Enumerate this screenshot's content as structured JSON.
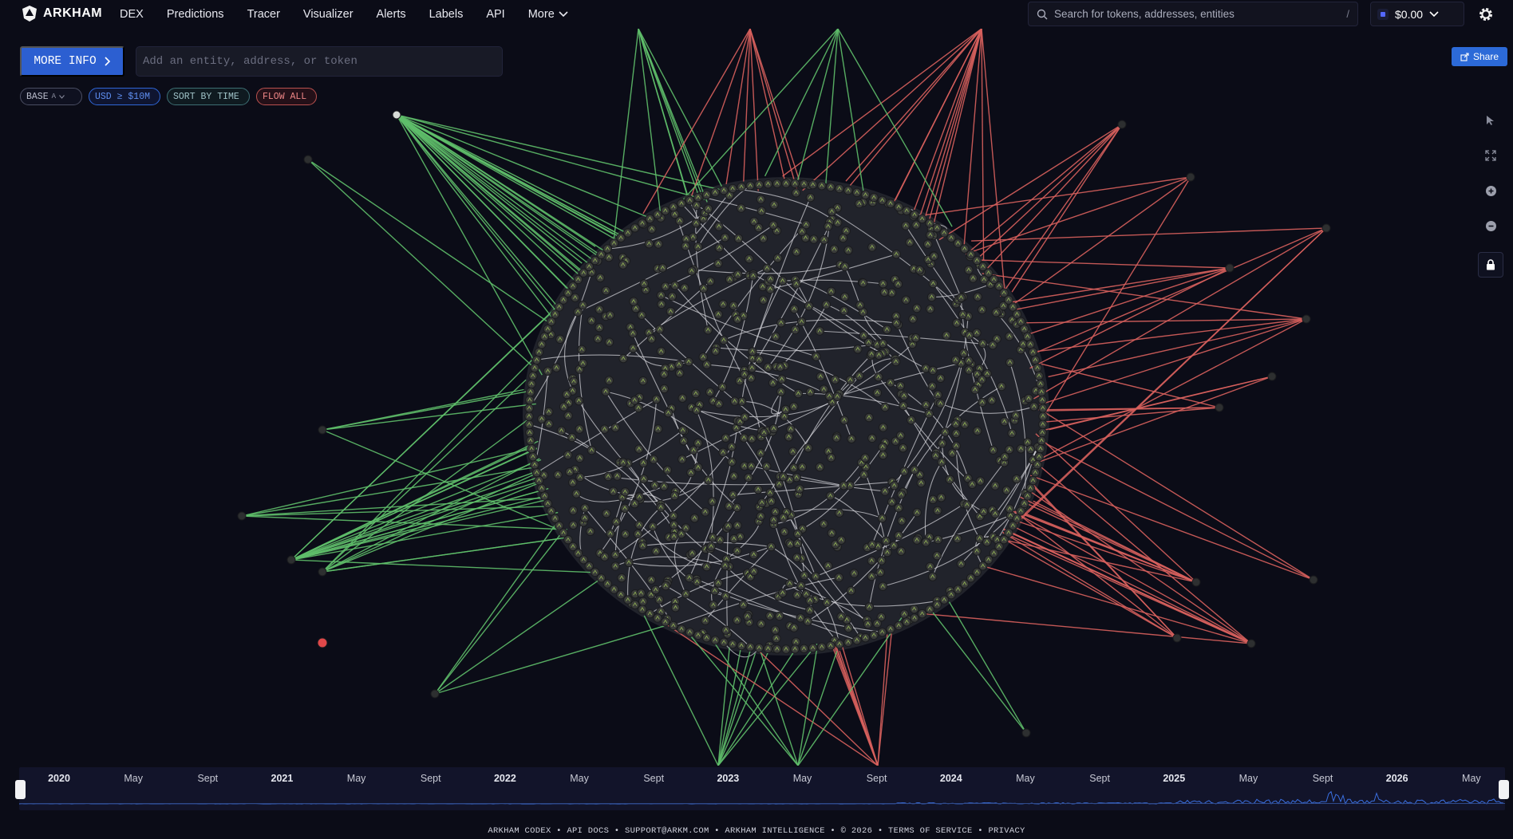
{
  "app": {
    "brand": "ARKHAM"
  },
  "nav": {
    "items": [
      "DEX",
      "Predictions",
      "Tracer",
      "Visualizer",
      "Alerts",
      "Labels",
      "API"
    ],
    "more_label": "More"
  },
  "search": {
    "placeholder": "Search for tokens, addresses, entities",
    "shortcut": "/"
  },
  "wallet": {
    "balance": "$0.00"
  },
  "toolbar": {
    "more_info_label": "MORE INFO",
    "entity_placeholder": "Add an entity, address, or token",
    "share_label": "Share"
  },
  "filters": {
    "base_label": "BASE",
    "base_hint": "A",
    "usd_label": "USD ≥ $10M",
    "sort_label": "SORT BY TIME",
    "flow_label": "FLOW ALL"
  },
  "side_tools": [
    "cursor-icon",
    "fit-icon",
    "zoom-in-icon",
    "zoom-out-icon",
    "lock-icon"
  ],
  "graph": {
    "edge_colors": {
      "inflow": "#5fbf6a",
      "outflow": "#d8615d",
      "internal": "#d9d9de"
    },
    "node_color": "#3a3c3a",
    "hub_color": "#2d2f30",
    "highlight_node_color": "#e0484a"
  },
  "timeline": {
    "labels": [
      {
        "text": "2020",
        "year": true
      },
      {
        "text": "May",
        "year": false
      },
      {
        "text": "Sept",
        "year": false
      },
      {
        "text": "2021",
        "year": true
      },
      {
        "text": "May",
        "year": false
      },
      {
        "text": "Sept",
        "year": false
      },
      {
        "text": "2022",
        "year": true
      },
      {
        "text": "May",
        "year": false
      },
      {
        "text": "Sept",
        "year": false
      },
      {
        "text": "2023",
        "year": true
      },
      {
        "text": "May",
        "year": false
      },
      {
        "text": "Sept",
        "year": false
      },
      {
        "text": "2024",
        "year": true
      },
      {
        "text": "May",
        "year": false
      },
      {
        "text": "Sept",
        "year": false
      },
      {
        "text": "2025",
        "year": true
      },
      {
        "text": "May",
        "year": false
      },
      {
        "text": "Sept",
        "year": false
      },
      {
        "text": "2026",
        "year": true
      },
      {
        "text": "May",
        "year": false
      }
    ]
  },
  "footer": {
    "text": "ARKHAM CODEX • API DOCS • SUPPORT@ARKM.COM • ARKHAM INTELLIGENCE • © 2026 • TERMS OF SERVICE • PRIVACY"
  }
}
